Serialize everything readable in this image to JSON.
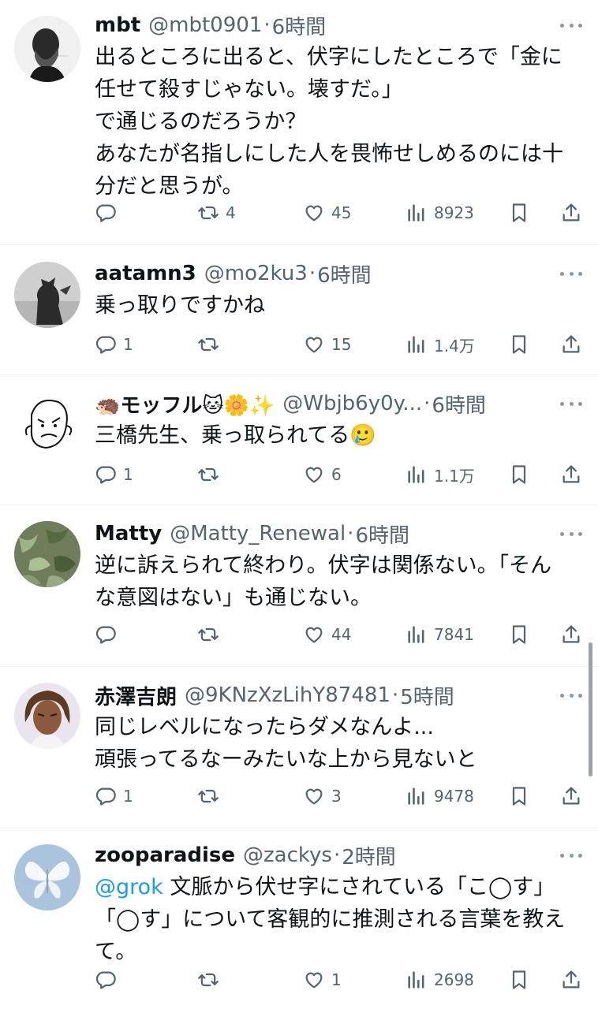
{
  "posts": [
    {
      "name": "mbt",
      "handle": "@mbt0901",
      "time": "6時間",
      "lines": [
        "出るところに出ると、伏字にしたところで「金に",
        "任せて殺すじゃない。壊すだ。」",
        "で通じるのだろうか？",
        "あなたが名指しにした人を畏怖せしめるのには十",
        "分だと思うが。"
      ],
      "replies": "",
      "reposts": "4",
      "likes": "45",
      "views": "8923"
    },
    {
      "name": "aatamn3",
      "handle": "@mo2ku3",
      "time": "6時間",
      "lines": [
        "乗っ取りですかね"
      ],
      "replies": "1",
      "reposts": "",
      "likes": "15",
      "views": "1.4万"
    },
    {
      "name": "🦔モッフル🐱🌼✨",
      "handle": "@Wbjb6y0y...",
      "time": "6時間",
      "lines": [
        "三橋先生、乗っ取られてる🥲"
      ],
      "replies": "1",
      "reposts": "",
      "likes": "6",
      "views": "1.1万"
    },
    {
      "name": "Matty",
      "handle": "@Matty_Renewal",
      "time": "6時間",
      "lines": [
        "逆に訴えられて終わり。伏字は関係ない。「そん",
        "な意図はない」も通じない。"
      ],
      "replies": "",
      "reposts": "",
      "likes": "44",
      "views": "7841"
    },
    {
      "name": "赤澤吉朗",
      "handle": "@9KNzXzLihY87481",
      "time": "5時間",
      "lines": [
        "同じレベルになったらダメなんよ...",
        "頑張ってるなーみたいな上から見ないと"
      ],
      "replies": "1",
      "reposts": "",
      "likes": "3",
      "views": "9478"
    },
    {
      "name": "zooparadise",
      "handle": "@zackys",
      "time": "2時間",
      "mention": "@grok",
      "lines": [
        " 文脈から伏せ字にされている「こ◯す」",
        "「◯す」について客観的に推測される言葉を教え",
        "て。"
      ],
      "replies": "",
      "reposts": "",
      "likes": "1",
      "views": "2698"
    }
  ],
  "separator": "·",
  "icons": [
    "reply-icon",
    "repost-icon",
    "like-icon",
    "views-icon",
    "bookmark-icon",
    "share-icon",
    "more-icon"
  ],
  "colors": {
    "text": "#0f1419",
    "secondary": "#536471",
    "link": "#1d9bf0",
    "divider": "#eff3f4"
  }
}
